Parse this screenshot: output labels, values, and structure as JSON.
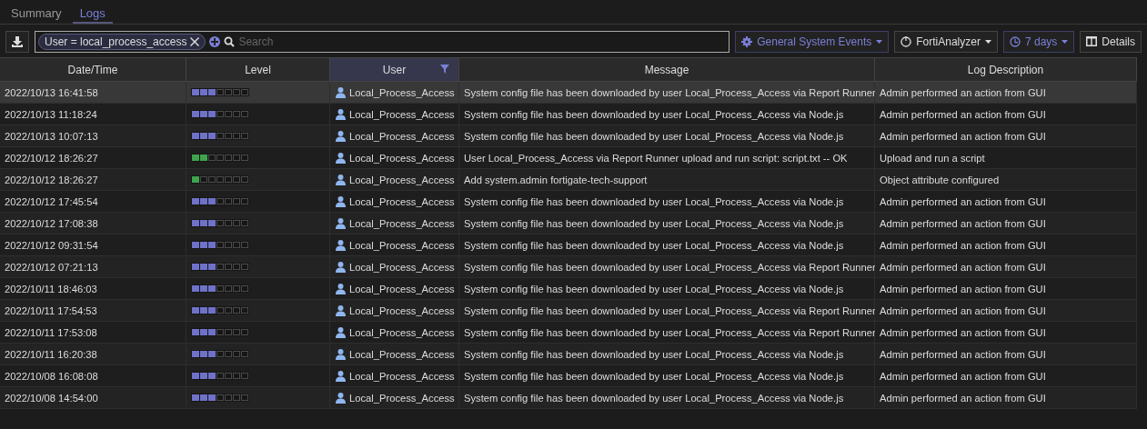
{
  "tabs": [
    {
      "label": "Summary",
      "selected": false
    },
    {
      "label": "Logs",
      "selected": true
    }
  ],
  "toolbar": {
    "filter_chip": "User = local_process_access",
    "search": {
      "placeholder": "Search"
    },
    "dropdowns": [
      {
        "label": "General System Events",
        "kind": "gear"
      },
      {
        "label": "FortiAnalyzer",
        "kind": "device"
      },
      {
        "label": "7 days",
        "kind": "clock"
      }
    ],
    "details_button": "Details"
  },
  "table": {
    "columns": [
      {
        "label": "Date/Time",
        "filtered": false
      },
      {
        "label": "Level",
        "filtered": false
      },
      {
        "label": "User",
        "filtered": true
      },
      {
        "label": "Message",
        "filtered": false
      },
      {
        "label": "Log Description",
        "filtered": false
      }
    ],
    "rows": [
      {
        "datetime": "2022/10/13 16:41:58",
        "stars": 3,
        "color": "#6f72c8",
        "user": "Local_Process_Access",
        "message": "System config file has been downloaded by user Local_Process_Access via Report Runner",
        "description": "Admin performed an action from GUI",
        "selected": true
      },
      {
        "datetime": "2022/10/13 11:18:24",
        "stars": 3,
        "color": "#6f72c8",
        "user": "Local_Process_Access",
        "message": "System config file has been downloaded by user Local_Process_Access via Node.js",
        "description": "Admin performed an action from GUI",
        "selected": false
      },
      {
        "datetime": "2022/10/13 10:07:13",
        "stars": 3,
        "color": "#6f72c8",
        "user": "Local_Process_Access",
        "message": "System config file has been downloaded by user Local_Process_Access via Node.js",
        "description": "Admin performed an action from GUI",
        "selected": false
      },
      {
        "datetime": "2022/10/12 18:26:27",
        "stars": 2,
        "color": "#3fa34d",
        "user": "Local_Process_Access",
        "message": "User Local_Process_Access via Report Runner upload and run script: script.txt -- OK",
        "description": "Upload and run a script",
        "selected": false
      },
      {
        "datetime": "2022/10/12 18:26:27",
        "stars": 1,
        "color": "#3fa34d",
        "user": "Local_Process_Access",
        "message": "Add system.admin fortigate-tech-support",
        "description": "Object attribute configured",
        "selected": false
      },
      {
        "datetime": "2022/10/12 17:45:54",
        "stars": 3,
        "color": "#6f72c8",
        "user": "Local_Process_Access",
        "message": "System config file has been downloaded by user Local_Process_Access via Node.js",
        "description": "Admin performed an action from GUI",
        "selected": false
      },
      {
        "datetime": "2022/10/12 17:08:38",
        "stars": 3,
        "color": "#6f72c8",
        "user": "Local_Process_Access",
        "message": "System config file has been downloaded by user Local_Process_Access via Node.js",
        "description": "Admin performed an action from GUI",
        "selected": false
      },
      {
        "datetime": "2022/10/12 09:31:54",
        "stars": 3,
        "color": "#6f72c8",
        "user": "Local_Process_Access",
        "message": "System config file has been downloaded by user Local_Process_Access via Node.js",
        "description": "Admin performed an action from GUI",
        "selected": false
      },
      {
        "datetime": "2022/10/12 07:21:13",
        "stars": 3,
        "color": "#6f72c8",
        "user": "Local_Process_Access",
        "message": "System config file has been downloaded by user Local_Process_Access via Report Runner",
        "description": "Admin performed an action from GUI",
        "selected": false
      },
      {
        "datetime": "2022/10/11 18:46:03",
        "stars": 3,
        "color": "#6f72c8",
        "user": "Local_Process_Access",
        "message": "System config file has been downloaded by user Local_Process_Access via Node.js",
        "description": "Admin performed an action from GUI",
        "selected": false
      },
      {
        "datetime": "2022/10/11 17:54:53",
        "stars": 3,
        "color": "#6f72c8",
        "user": "Local_Process_Access",
        "message": "System config file has been downloaded by user Local_Process_Access via Report Runner",
        "description": "Admin performed an action from GUI",
        "selected": false
      },
      {
        "datetime": "2022/10/11 17:53:08",
        "stars": 3,
        "color": "#6f72c8",
        "user": "Local_Process_Access",
        "message": "System config file has been downloaded by user Local_Process_Access via Report Runner",
        "description": "Admin performed an action from GUI",
        "selected": false
      },
      {
        "datetime": "2022/10/11 16:20:38",
        "stars": 3,
        "color": "#6f72c8",
        "user": "Local_Process_Access",
        "message": "System config file has been downloaded by user Local_Process_Access via Node.js",
        "description": "Admin performed an action from GUI",
        "selected": false
      },
      {
        "datetime": "2022/10/08 16:08:08",
        "stars": 3,
        "color": "#6f72c8",
        "user": "Local_Process_Access",
        "message": "System config file has been downloaded by user Local_Process_Access via Node.js",
        "description": "Admin performed an action from GUI",
        "selected": false
      },
      {
        "datetime": "2022/10/08 14:54:00",
        "stars": 3,
        "color": "#6f72c8",
        "user": "Local_Process_Access",
        "message": "System config file has been downloaded by user Local_Process_Access via Node.js",
        "description": "Admin performed an action from GUI",
        "selected": false
      }
    ]
  }
}
